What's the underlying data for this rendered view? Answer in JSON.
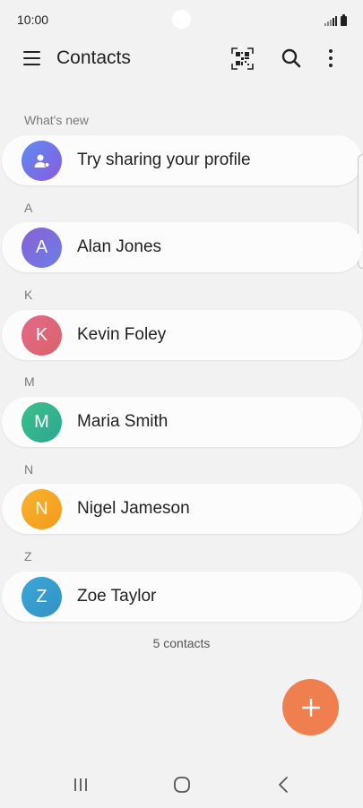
{
  "status_bar": {
    "time": "10:00"
  },
  "app_bar": {
    "title": "Contacts",
    "icons": [
      "menu-icon",
      "qr-code-icon",
      "search-icon",
      "more-options-icon"
    ]
  },
  "whats_new": {
    "header": "What's new",
    "item_label": "Try sharing your profile",
    "avatar_color": "#6a6fe0"
  },
  "sections": [
    {
      "letter": "A",
      "name": "Alan Jones",
      "initial": "A",
      "color": "#7b6fd8"
    },
    {
      "letter": "K",
      "name": "Kevin Foley",
      "initial": "K",
      "color": "#e06a7c"
    },
    {
      "letter": "M",
      "name": "Maria Smith",
      "initial": "M",
      "color": "#3ab68e"
    },
    {
      "letter": "N",
      "name": "Nigel Jameson",
      "initial": "N",
      "color": "#f5a623"
    },
    {
      "letter": "Z",
      "name": "Zoe Taylor",
      "initial": "Z",
      "color": "#3a9ccf"
    }
  ],
  "footer": {
    "count_text": "5 contacts"
  },
  "fab": {
    "icon": "plus-icon",
    "color": "#f07f50"
  },
  "nav_bar": {
    "icons": [
      "recent-apps-icon",
      "home-icon",
      "back-icon"
    ]
  }
}
